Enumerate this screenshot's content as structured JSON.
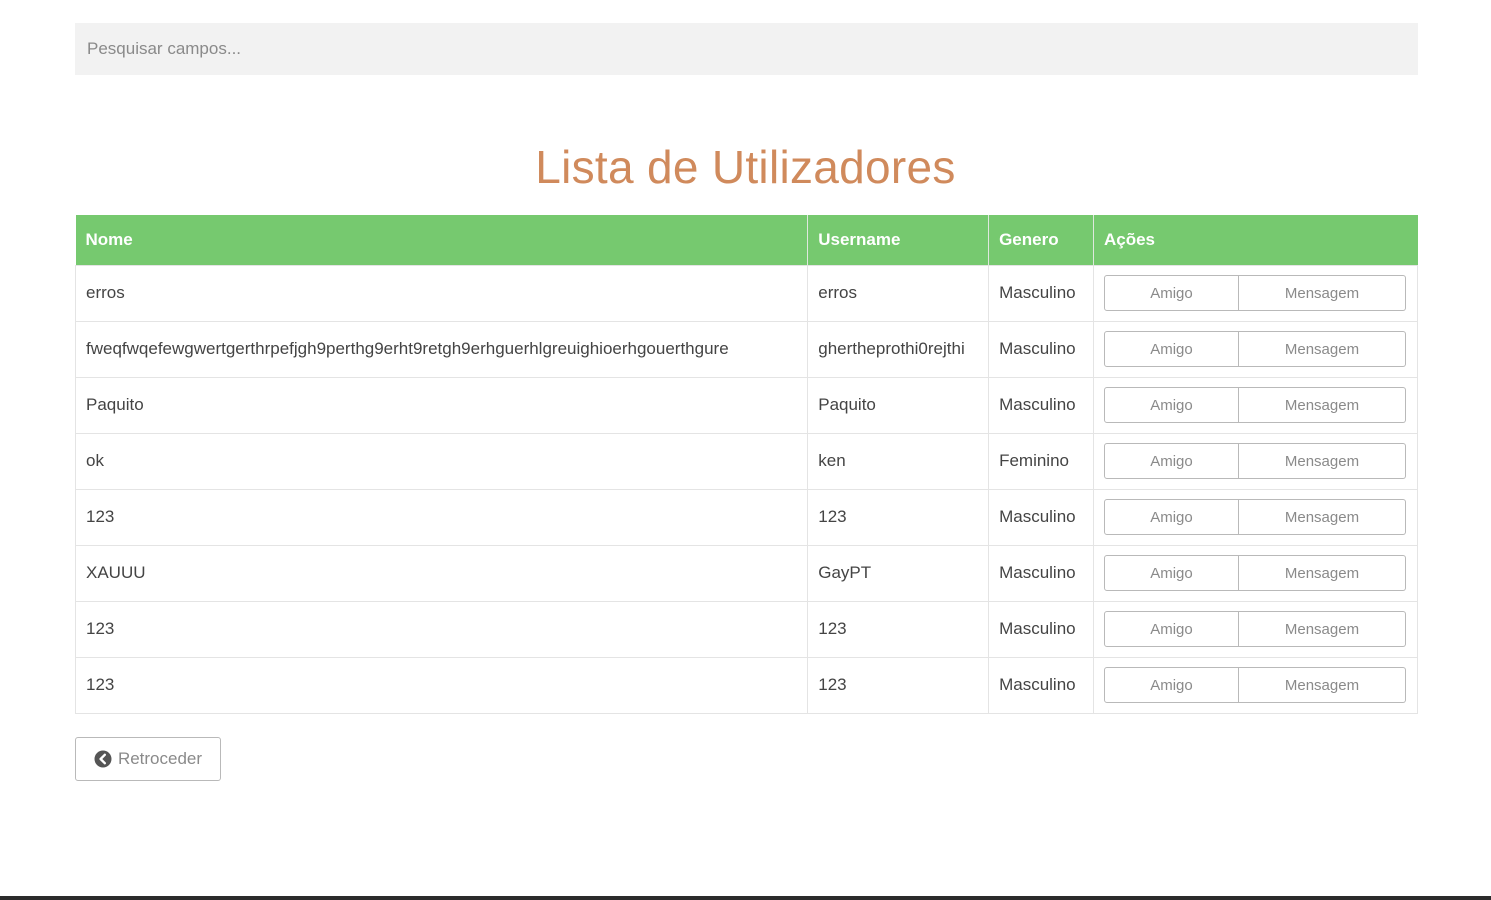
{
  "search": {
    "placeholder": "Pesquisar campos..."
  },
  "page_title": "Lista de Utilizadores",
  "table": {
    "headers": [
      "Nome",
      "Username",
      "Genero",
      "Ações"
    ],
    "rows": [
      {
        "nome": "erros",
        "username": "erros",
        "genero": "Masculino"
      },
      {
        "nome": "fweqfwqefewgwertgerthrpefjgh9perthg9erht9retgh9erhguerhlgreuighioerhgouerthgure",
        "username": "ghertheprothi0rejthi",
        "genero": "Masculino"
      },
      {
        "nome": "Paquito",
        "username": "Paquito",
        "genero": "Masculino"
      },
      {
        "nome": "ok",
        "username": "ken",
        "genero": "Feminino"
      },
      {
        "nome": "123",
        "username": "123",
        "genero": "Masculino"
      },
      {
        "nome": "XAUUU",
        "username": "GayPT",
        "genero": "Masculino"
      },
      {
        "nome": "123",
        "username": "123",
        "genero": "Masculino"
      },
      {
        "nome": "123",
        "username": "123",
        "genero": "Masculino"
      }
    ],
    "action_labels": {
      "amigo": "Amigo",
      "mensagem": "Mensagem"
    }
  },
  "back_button": {
    "label": "Retroceder",
    "icon": "chevron-left-circle-icon"
  },
  "colors": {
    "header_green": "#76c96f",
    "title_orange": "#d08a5c",
    "search_bg": "#f2f2f2"
  }
}
